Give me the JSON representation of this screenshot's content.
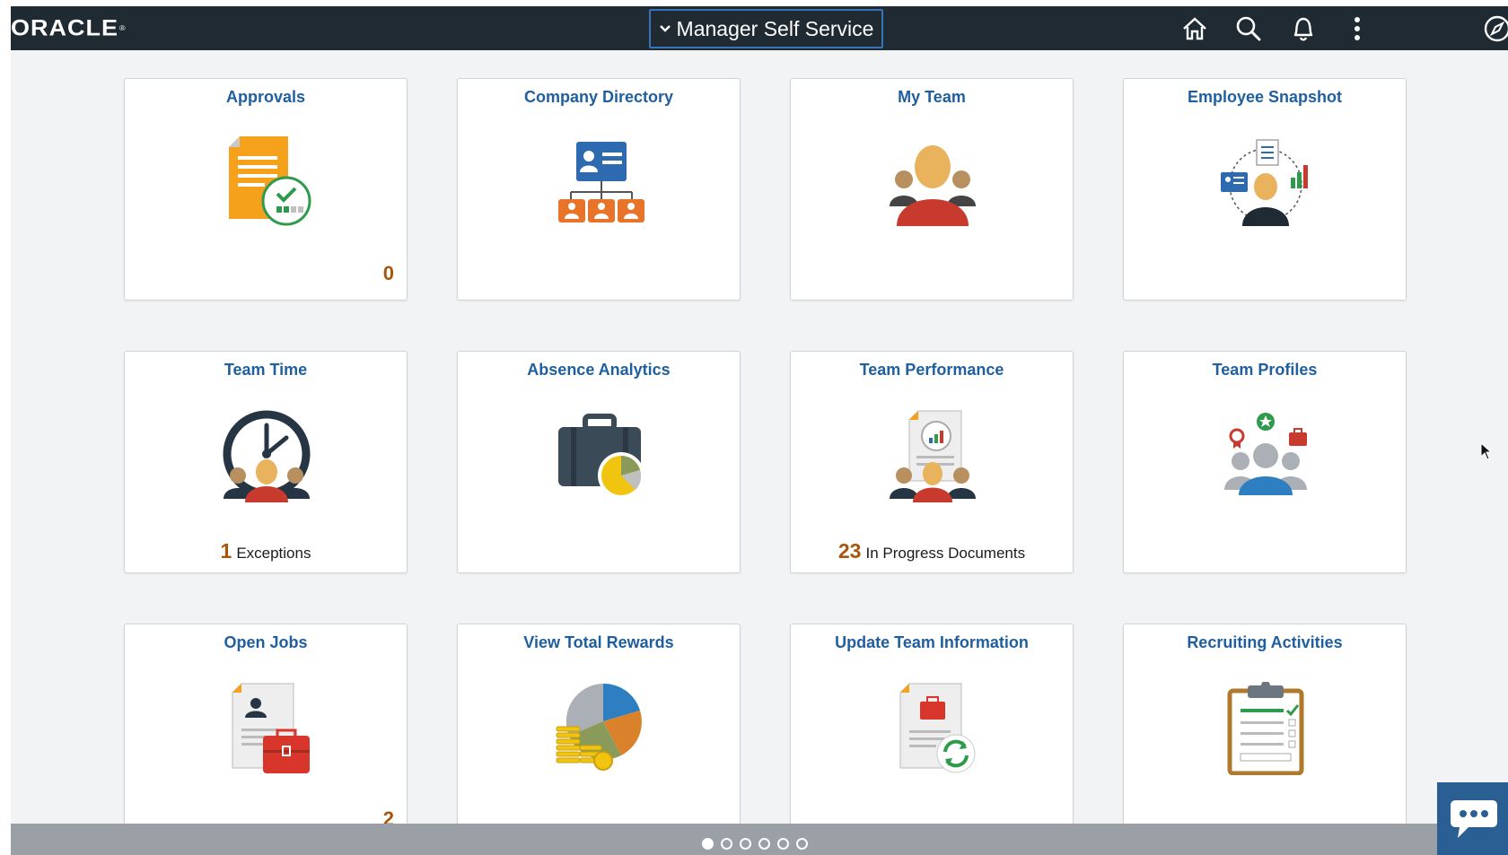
{
  "header": {
    "logo_text": "ORACLE",
    "logo_mark": "®",
    "homepage_title": "Manager Self Service",
    "icons": [
      "home-icon",
      "search-icon",
      "notifications-icon",
      "actions-menu-icon",
      "navbar-icon"
    ]
  },
  "tiles": [
    {
      "title": "Approvals",
      "icon": "approvals-icon",
      "count": "0"
    },
    {
      "title": "Company Directory",
      "icon": "company-directory-icon"
    },
    {
      "title": "My Team",
      "icon": "my-team-icon"
    },
    {
      "title": "Employee Snapshot",
      "icon": "employee-snapshot-icon"
    },
    {
      "title": "Team Time",
      "icon": "team-time-icon",
      "metric_value": "1",
      "metric_label": "Exceptions"
    },
    {
      "title": "Absence Analytics",
      "icon": "absence-analytics-icon"
    },
    {
      "title": "Team Performance",
      "icon": "team-performance-icon",
      "metric_value": "23",
      "metric_label": "In Progress Documents"
    },
    {
      "title": "Team Profiles",
      "icon": "team-profiles-icon"
    },
    {
      "title": "Open Jobs",
      "icon": "open-jobs-icon",
      "count": "2"
    },
    {
      "title": "View Total Rewards",
      "icon": "total-rewards-icon"
    },
    {
      "title": "Update Team Information",
      "icon": "update-team-info-icon"
    },
    {
      "title": "Recruiting Activities",
      "icon": "recruiting-activities-icon"
    }
  ],
  "pagination": {
    "pages": 6,
    "active_page": 1
  },
  "chat": {
    "icon": "chat-icon"
  },
  "colors": {
    "header_bg": "#1f2a33",
    "tile_title": "#1f5f9e",
    "count": "#a8560c",
    "chat_bg": "#2a5f94"
  }
}
